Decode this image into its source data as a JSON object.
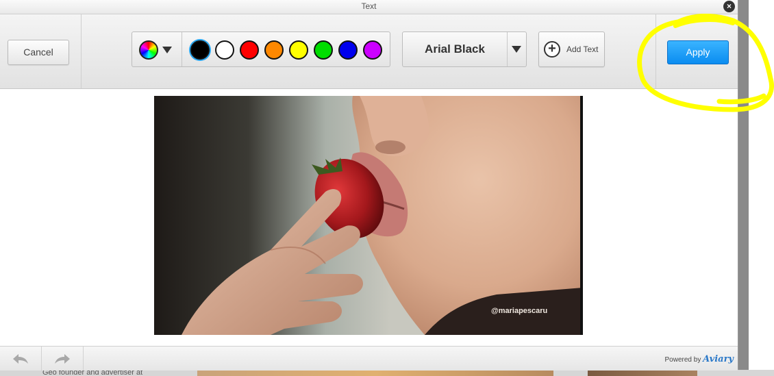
{
  "dialog": {
    "title": "Text"
  },
  "toolbar": {
    "cancel_label": "Cancel",
    "apply_label": "Apply",
    "add_text_label": "Add Text",
    "font_name": "Arial Black",
    "colors": [
      {
        "name": "black",
        "hex": "#000000",
        "selected": true
      },
      {
        "name": "white",
        "hex": "#ffffff",
        "selected": false
      },
      {
        "name": "red",
        "hex": "#ff0000",
        "selected": false
      },
      {
        "name": "orange",
        "hex": "#ff8800",
        "selected": false
      },
      {
        "name": "yellow",
        "hex": "#ffff00",
        "selected": false
      },
      {
        "name": "green",
        "hex": "#00dd00",
        "selected": false
      },
      {
        "name": "blue",
        "hex": "#0000ee",
        "selected": false
      },
      {
        "name": "purple",
        "hex": "#cc00ff",
        "selected": false
      }
    ],
    "accent": "#1a9cf5"
  },
  "canvas": {
    "watermark": "@mariapescaru"
  },
  "footer": {
    "powered_by": "Powered by",
    "brand": "Aviary"
  },
  "background_page": {
    "snippet": "Geo founder and advertiser at"
  },
  "icons": [
    "close-icon",
    "color-wheel-icon",
    "chevron-down-icon",
    "plus-icon",
    "undo-icon",
    "redo-icon"
  ],
  "annotation": {
    "color": "#ffff00"
  }
}
